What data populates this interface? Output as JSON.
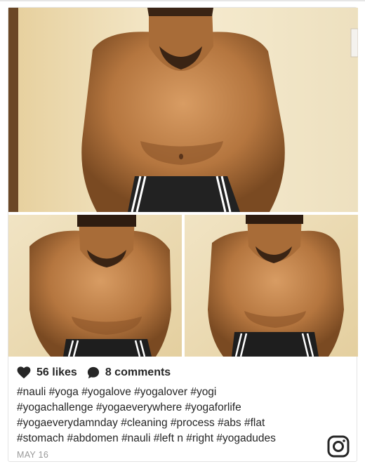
{
  "post": {
    "photo_alt": "",
    "likes_label": "56 likes",
    "comments_label": "8 comments",
    "caption_lines": [
      "#nauli #yoga #yogalove #yogalover #yogi",
      "#yogachallenge #yogaeverywhere #yogaforlife",
      "#yogaeverydamnday #cleaning #process #abs #flat",
      "#stomach #abdomen #nauli #left n #right #yogadudes"
    ],
    "date": "MAY 16"
  },
  "icons": {
    "like": "heart-icon",
    "comment": "comment-bubble-icon",
    "brand": "instagram-icon"
  },
  "colors": {
    "text": "#262626",
    "muted": "#999999",
    "border": "#e3e3e3"
  }
}
